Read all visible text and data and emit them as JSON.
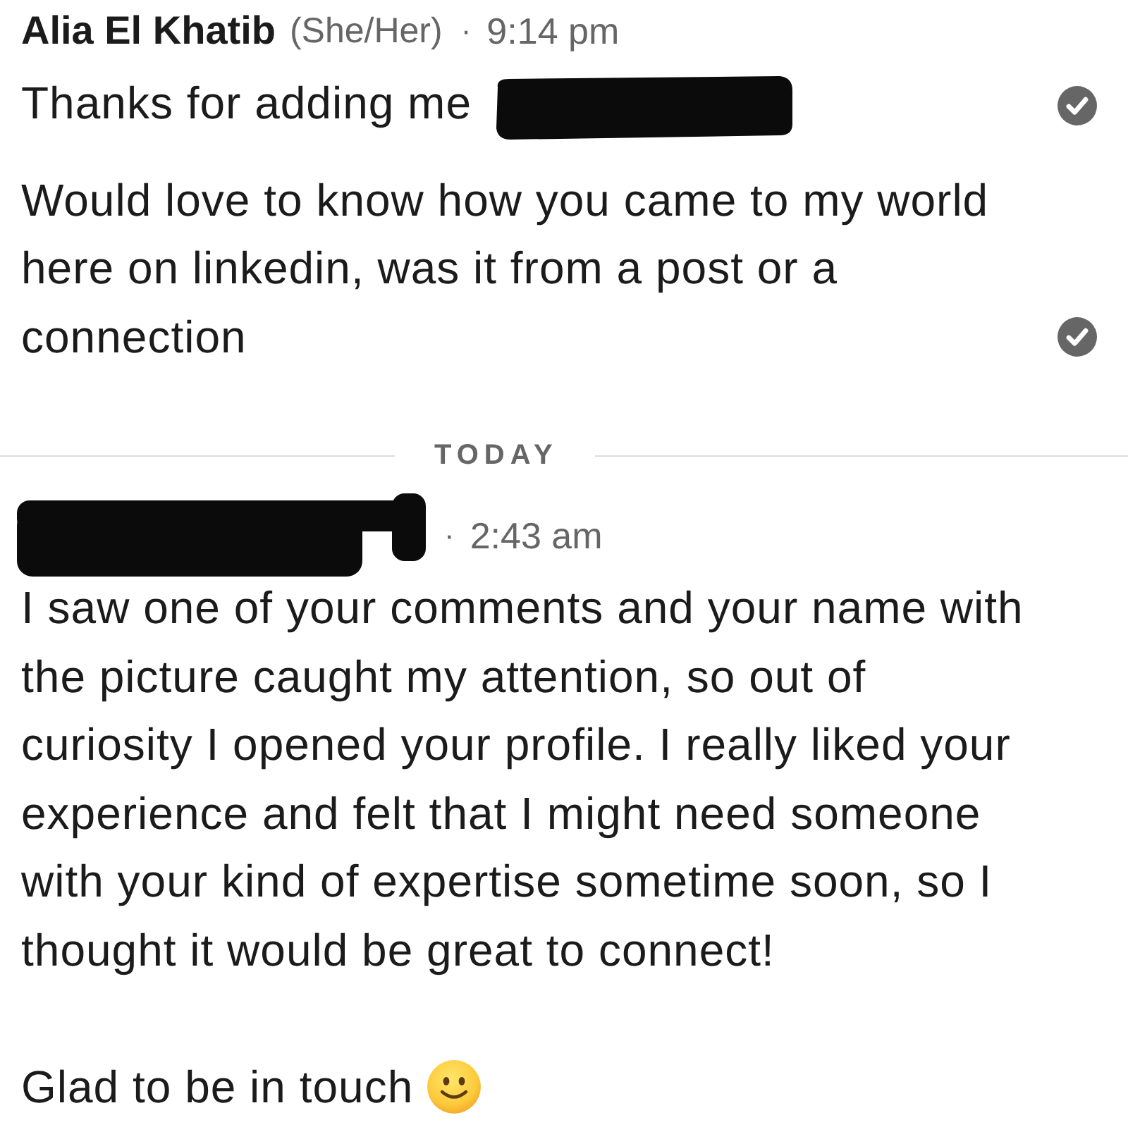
{
  "thread": [
    {
      "kind": "group",
      "sender": {
        "name": "Alia El Khatib",
        "pronouns": "(She/Her)",
        "redacted": false
      },
      "separator": "·",
      "time": "9:14 pm",
      "messages": [
        {
          "paragraphs": [
            "Thanks for adding me"
          ],
          "redacted_tail": true,
          "smiley": false,
          "seen": true
        },
        {
          "paragraphs": [
            "Would love to know how you came to my world here on linkedin, was it from a post or a connection"
          ],
          "redacted_tail": false,
          "smiley": false,
          "seen": true
        }
      ]
    },
    {
      "kind": "divider",
      "label": "TODAY"
    },
    {
      "kind": "group",
      "sender": {
        "redacted": true
      },
      "separator": "·",
      "time": "2:43 am",
      "messages": [
        {
          "paragraphs": [
            "I saw one of your comments and your name with the picture caught my attention, so out of curiosity I opened your profile. I really liked your experience and felt that I might need someone with your kind of expertise sometime soon, so I thought it would be great to connect!",
            "Glad to be in touch"
          ],
          "redacted_tail": false,
          "smiley": true,
          "seen": false
        }
      ]
    }
  ]
}
